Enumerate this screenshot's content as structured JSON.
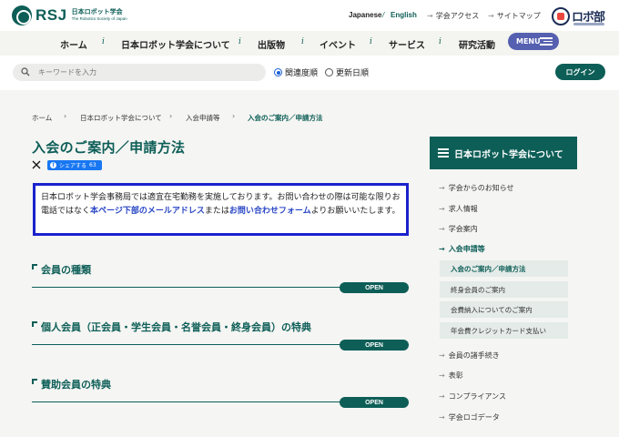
{
  "header": {
    "logo_text": "RSJ",
    "logo_sub_jp": "日本ロボット学会",
    "logo_sub_en": "The Robotics Society of Japan",
    "lang_ja": "Japanese",
    "lang_sep": "/",
    "lang_en": "English",
    "link_access": "学会アクセス",
    "link_sitemap": "サイトマップ",
    "robo_text": "ロボ部"
  },
  "nav": {
    "items": [
      "ホーム",
      "日本ロボット学会について",
      "出版物",
      "イベント",
      "サービス",
      "研究活動"
    ],
    "menu_label": "MENU"
  },
  "search": {
    "placeholder": "キーワードを入力",
    "sort_relevance": "関連度順",
    "sort_date": "更新日順",
    "selected": "関連度順",
    "login_label": "ログイン"
  },
  "breadcrumb": [
    "ホーム",
    "日本ロボット学会について",
    "入会申請等",
    "入会のご案内／申請方法"
  ],
  "main": {
    "title": "入会のご案内／申請方法",
    "share_label": "シェアする",
    "share_count": "63",
    "notice_part1": "日本ロボット学会事務局では適宜在宅勤務を実施しております。お問い合わせの際は可能な限りお電話ではなく",
    "notice_link1": "本ページ下部のメールアドレス",
    "notice_part2": "または",
    "notice_link2": "お問い合わせフォーム",
    "notice_part3": "よりお願いいたします。",
    "sections": [
      {
        "title": "会員の種類",
        "button": "OPEN"
      },
      {
        "title": "個人会員（正会員・学生会員・名誉会員・終身会員）の特典",
        "button": "OPEN"
      },
      {
        "title": "賛助会員の特典",
        "button": "OPEN"
      }
    ]
  },
  "sidebar": {
    "heading": "日本ロボット学会について",
    "items": [
      "学会からのお知らせ",
      "求人情報",
      "学会案内",
      "入会申請等"
    ],
    "subitems": [
      "入会のご案内／申請方法",
      "終身会員のご案内",
      "会費納入についてのご案内",
      "年会費クレジットカード支払い"
    ],
    "items_after": [
      "会員の諸手続き",
      "表彰",
      "コンプライアンス",
      "学会ロゴデータ"
    ]
  }
}
